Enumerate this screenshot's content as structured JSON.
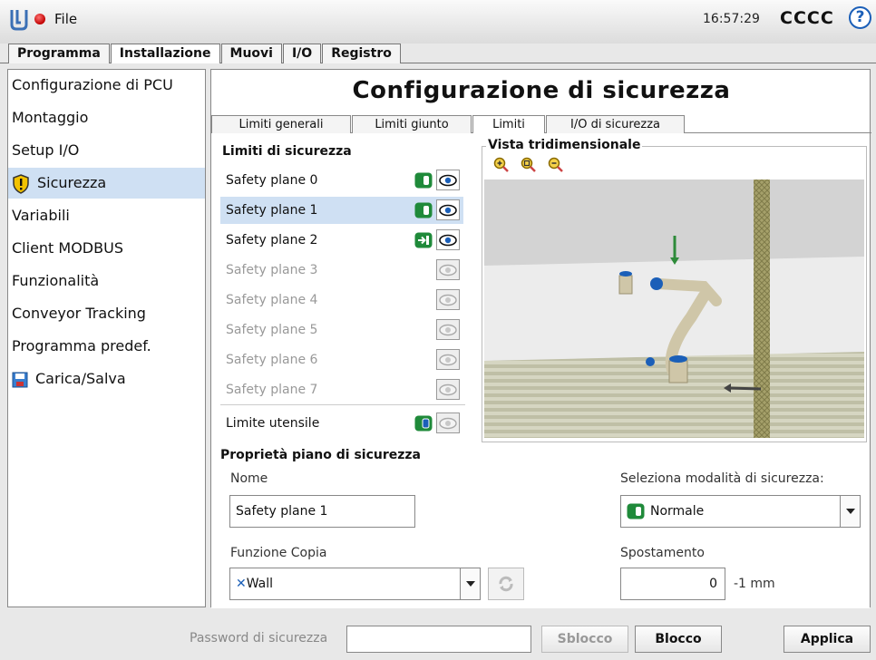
{
  "header": {
    "file_menu": "File",
    "time": "16:57:29",
    "robot_name": "CCCC",
    "help_label": "?"
  },
  "main_tabs": [
    {
      "label": "Programma"
    },
    {
      "label": "Installazione"
    },
    {
      "label": "Muovi"
    },
    {
      "label": "I/O"
    },
    {
      "label": "Registro"
    }
  ],
  "sidebar": {
    "items": [
      {
        "label": "Configurazione di PCU"
      },
      {
        "label": "Montaggio"
      },
      {
        "label": "Setup I/O"
      },
      {
        "label": "Sicurezza",
        "icon": "warning-shield-icon",
        "active": true
      },
      {
        "label": "Variabili"
      },
      {
        "label": "Client MODBUS"
      },
      {
        "label": "Funzionalità"
      },
      {
        "label": "Conveyor Tracking"
      },
      {
        "label": "Programma predef."
      },
      {
        "label": "Carica/Salva",
        "icon": "save-disk-icon"
      }
    ]
  },
  "content": {
    "title": "Configurazione di sicurezza",
    "subtabs": [
      {
        "label": "Limiti generali"
      },
      {
        "label": "Limiti giunto"
      },
      {
        "label": "Limiti",
        "active": true
      },
      {
        "label": "I/O di sicurezza"
      }
    ],
    "limits_section": "Limiti di sicurezza",
    "planes": [
      {
        "label": "Safety plane 0",
        "state": "normal"
      },
      {
        "label": "Safety plane 1",
        "state": "normal"
      },
      {
        "label": "Safety plane 2",
        "state": "trigger"
      },
      {
        "label": "Safety plane 3",
        "state": "disabled"
      },
      {
        "label": "Safety plane 4",
        "state": "disabled"
      },
      {
        "label": "Safety plane 5",
        "state": "disabled"
      },
      {
        "label": "Safety plane 6",
        "state": "disabled"
      },
      {
        "label": "Safety plane 7",
        "state": "disabled"
      }
    ],
    "tool_limit": "Limite utensile",
    "view_title": "Vista tridimensionale",
    "properties_section": "Proprietà piano di sicurezza",
    "name_label": "Nome",
    "name_value": "Safety plane 1",
    "mode_label": "Seleziona modalità di sicurezza:",
    "mode_value": "Normale",
    "copy_label": "Funzione Copia",
    "copy_value": "Wall",
    "offset_label": "Spostamento",
    "offset_value": "0",
    "offset_unit": "-1 mm"
  },
  "footer": {
    "password_label": "Password di sicurezza",
    "unlock_label": "Sblocco",
    "lock_label": "Blocco",
    "apply_label": "Applica"
  },
  "colors": {
    "accent_blue": "#1b5fb8",
    "selection": "#cfe0f3",
    "toggle_green": "#1f8a3a"
  }
}
